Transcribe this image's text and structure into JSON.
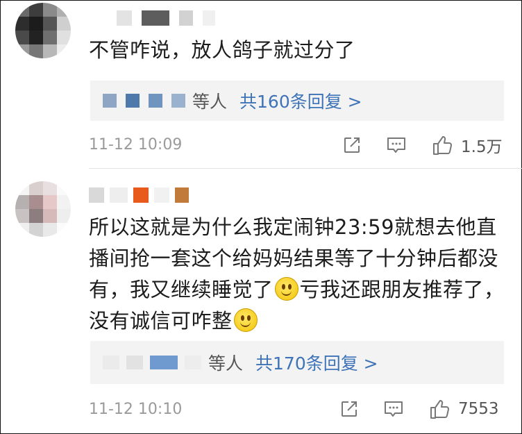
{
  "comments": [
    {
      "text": "不管咋说，放人鸽子就过分了",
      "replies_suffix": "等人",
      "replies_link": "共160条回复 >",
      "time": "11-12 10:09",
      "likes": "1.5万"
    },
    {
      "text_parts": [
        "所以这就是为什么我定闹钟23:59就想去他直播间抢一套这个给妈妈结果等了十分钟后都没有，我又继续睡觉了",
        "亏我还跟朋友推荐了，没有诚信可咋整"
      ],
      "replies_suffix": "等人",
      "replies_link": "共170条回复 >",
      "time": "11-12 10:10",
      "likes": "7553"
    }
  ],
  "icons": {
    "share": "share-icon",
    "comment": "comment-icon",
    "like": "thumbs-up-icon",
    "emoji": "smiley-emoji-icon"
  },
  "colors": {
    "link": "#3e73b8",
    "meta": "#9a9a9a",
    "reply_bg": "#f3f3f3"
  }
}
